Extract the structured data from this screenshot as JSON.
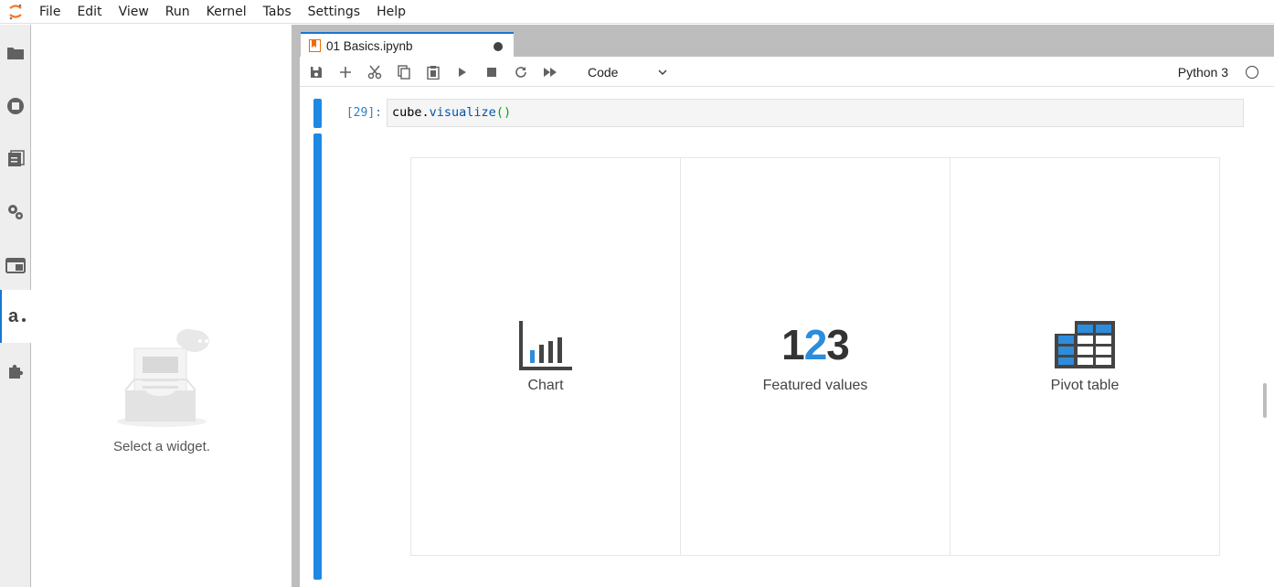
{
  "menubar": {
    "items": [
      "File",
      "Edit",
      "View",
      "Run",
      "Kernel",
      "Tabs",
      "Settings",
      "Help"
    ]
  },
  "activitybar": {
    "items": [
      {
        "icon": "folder-icon"
      },
      {
        "icon": "running-icon"
      },
      {
        "icon": "commands-icon"
      },
      {
        "icon": "property-inspector-icon"
      },
      {
        "icon": "tabs-icon"
      },
      {
        "icon": "atoti-icon",
        "active": true
      },
      {
        "icon": "extension-icon"
      }
    ]
  },
  "sidepanel": {
    "empty_text": "Select a widget."
  },
  "notebook": {
    "tab_title": "01 Basics.ipynb",
    "toolbar": {
      "cell_type": "Code",
      "kernel_name": "Python 3"
    },
    "cell": {
      "prompt": "[29]:",
      "code": {
        "var": "cube",
        "dot": ".",
        "fn": "visualize",
        "parens": "()"
      }
    }
  },
  "widget": {
    "options": [
      {
        "label": "Chart",
        "icon": "chart-icon"
      },
      {
        "label": "Featured values",
        "number_parts": [
          "1",
          "2",
          "3"
        ],
        "icon": "featured-values-icon"
      },
      {
        "label": "Pivot table",
        "icon": "pivot-table-icon"
      }
    ]
  },
  "colors": {
    "accent": "#1e88e5",
    "widget_accent": "#2e8cdc",
    "widget_dark": "#444444"
  }
}
